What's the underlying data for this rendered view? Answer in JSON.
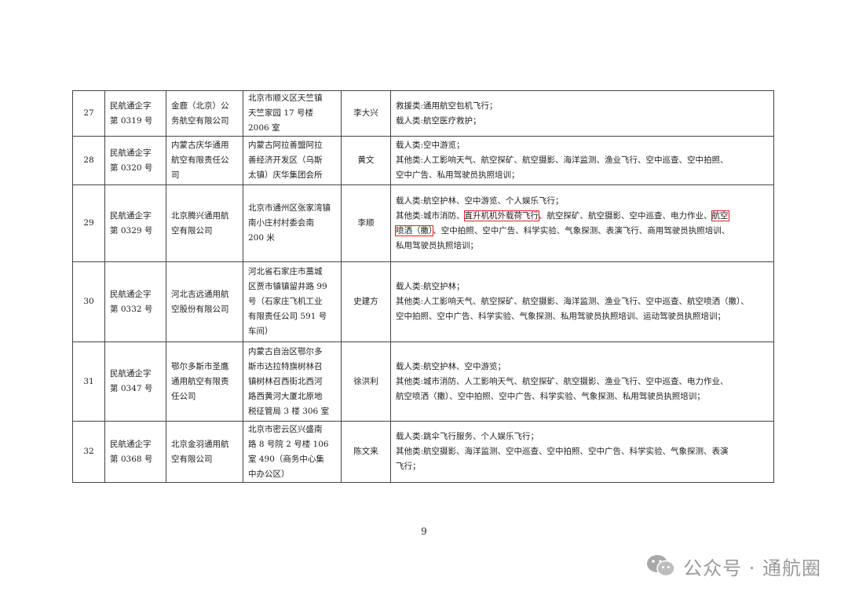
{
  "table": {
    "rows": [
      {
        "no": "27",
        "cert": [
          "民航通企字",
          "第 0319 号"
        ],
        "company": [
          "金鹿（北京）公",
          "务航空有限公司"
        ],
        "address": [
          "北京市顺义区天竺镇",
          "天竺家园 17 号楼",
          "2006 室"
        ],
        "person": "李大兴",
        "scope": [
          [
            "救援类:通用航空包机飞行；"
          ],
          [
            "载人类:航空医疗救护；"
          ]
        ]
      },
      {
        "no": "28",
        "cert": [
          "民航通企字",
          "第 0320 号"
        ],
        "company": [
          "内蒙古庆华通用",
          "航空有限责任公",
          "司"
        ],
        "address": [
          "内蒙古阿拉善盟阿拉",
          "善经济开发区（乌斯",
          "太镇）庆华集团会所"
        ],
        "person": "黄文",
        "scope": [
          [
            "载人类:空中游览；"
          ],
          [
            "其他类:人工影响天气、航空探矿、航空摄影、海洋监测、渔业飞行、空中巡查、空中拍照、"
          ],
          [
            "空中广告、私用驾驶员执照培训；"
          ]
        ]
      },
      {
        "no": "29",
        "cert": [
          "民航通企字",
          "第 0329 号"
        ],
        "company": [
          "北京腾兴通用航",
          "空有限公司"
        ],
        "address": [
          "北京市通州区张家湾镇",
          "南小庄村村委会南",
          "200 米"
        ],
        "person": "李顺",
        "scope": [
          [
            "载人类:航空护林、空中游览、个人娱乐飞行；"
          ],
          [
            "其他类:城市消防、",
            {
              "hl": "直升机机外载荷飞行"
            },
            "、航空探矿、航空摄影、空中巡查、电力作业、",
            {
              "hl": "航空"
            }
          ],
          [
            {
              "hl": "喷洒（撒）"
            },
            "、空中拍照、空中广告、科学实验、气象探测、表演飞行、商用驾驶员执照培训、"
          ],
          [
            "私用驾驶员执照培训；"
          ]
        ]
      },
      {
        "no": "30",
        "cert": [
          "民航通企字",
          "第 0332 号"
        ],
        "company": [
          "河北吉远通用航",
          "空股份有限公司"
        ],
        "address": [
          "河北省石家庄市藁城",
          "区贾市镇镇留井路 99",
          "号（石家庄飞机工业",
          "有限责任公司 591 号",
          "车间）"
        ],
        "person": "史建方",
        "scope": [
          [
            "载人类:航空护林；"
          ],
          [
            "其他类:人工影响天气、航空探矿、航空摄影、海洋监测、渔业飞行、空中巡查、航空喷洒（撒）、"
          ],
          [
            "空中拍照、空中广告、科学实验、气象探测、私用驾驶员执照培训、运动驾驶员执照培训；"
          ]
        ]
      },
      {
        "no": "31",
        "cert": [
          "民航通企字",
          "第 0347 号"
        ],
        "company": [
          "鄂尔多斯市圣鹰",
          "通用航空有限责",
          "任公司"
        ],
        "address": [
          "内蒙古自治区鄂尔多",
          "斯市达拉特旗树林召",
          "镇树林召西街北西河",
          "路西黄河大厦北原地",
          "税征管局 3 楼 306 室"
        ],
        "person": "徐洪利",
        "scope": [
          [
            "载人类:航空护林、空中游览；"
          ],
          [
            "其他类:城市消防、人工影响天气、航空探矿、航空摄影、渔业飞行、空中巡查、电力作业、"
          ],
          [
            "航空喷洒（撒）、空中拍照、空中广告、科学实验、气象探测、私用驾驶员执照培训；"
          ]
        ]
      },
      {
        "no": "32",
        "cert": [
          "民航通企字",
          "第 0368 号"
        ],
        "company": [
          "北京金羽通用航",
          "空有限公司"
        ],
        "address": [
          "北京市密云区兴盛南",
          "路 8 号院 2 号楼 106",
          "室 490（商务中心集",
          "中办公区）"
        ],
        "person": "陈文来",
        "scope": [
          [
            "载人类:跳伞飞行服务、个人娱乐飞行；"
          ],
          [
            "其他类:航空摄影、海洋监测、空中巡查、空中拍照、空中广告、科学实验、气象探测、表演"
          ],
          [
            "飞行；"
          ]
        ]
      }
    ]
  },
  "page_number": "9",
  "watermark": {
    "text": "公众号 · 通航圈",
    "icon": "wechat-icon",
    "color": "#9a9a9a"
  },
  "colors": {
    "highlight_box": "#e02020",
    "border": "#444444"
  }
}
